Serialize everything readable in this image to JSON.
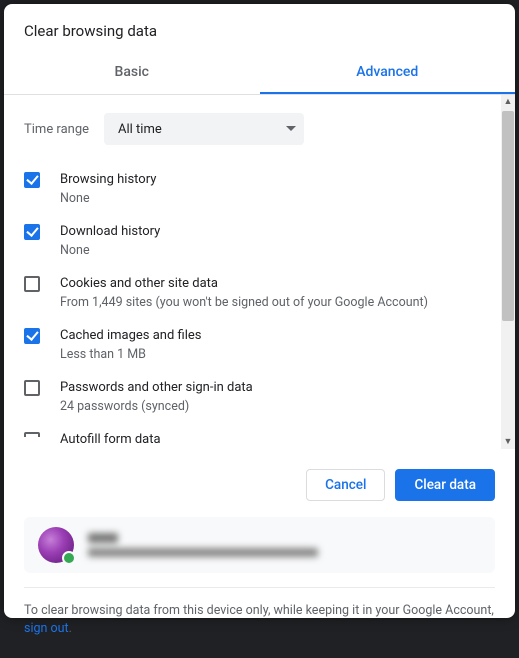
{
  "dialog": {
    "title": "Clear browsing data",
    "tabs": {
      "basic": "Basic",
      "advanced": "Advanced"
    }
  },
  "timerange": {
    "label": "Time range",
    "value": "All time"
  },
  "items": [
    {
      "checked": true,
      "title": "Browsing history",
      "sub": "None"
    },
    {
      "checked": true,
      "title": "Download history",
      "sub": "None"
    },
    {
      "checked": false,
      "title": "Cookies and other site data",
      "sub": "From 1,449 sites (you won't be signed out of your Google Account)"
    },
    {
      "checked": true,
      "title": "Cached images and files",
      "sub": "Less than 1 MB"
    },
    {
      "checked": false,
      "title": "Passwords and other sign-in data",
      "sub": "24 passwords (synced)"
    },
    {
      "checked": false,
      "title": "Autofill form data",
      "sub": ""
    }
  ],
  "buttons": {
    "cancel": "Cancel",
    "clear": "Clear data"
  },
  "footer": {
    "text_a": "To clear browsing data from this device only, while keeping it in your Google Account, ",
    "link": "sign out",
    "text_b": "."
  }
}
